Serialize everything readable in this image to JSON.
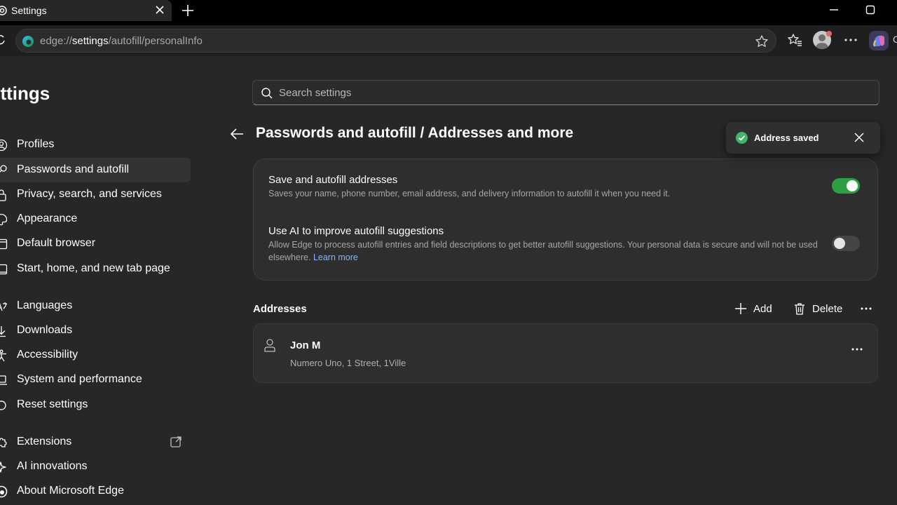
{
  "browser": {
    "tab_title": "Settings",
    "url_scheme": "edge://",
    "url_host": "settings",
    "url_path": "/autofill/personalInfo",
    "copilot_label": "C"
  },
  "sidebar": {
    "title": "ettings",
    "items": [
      {
        "label": "Profiles",
        "icon": "profile-icon"
      },
      {
        "label": "Passwords and autofill",
        "icon": "key-icon",
        "active": true
      },
      {
        "label": "Privacy, search, and services",
        "icon": "lock-icon"
      },
      {
        "label": "Appearance",
        "icon": "palette-icon"
      },
      {
        "label": "Default browser",
        "icon": "browser-icon"
      },
      {
        "label": "Start, home, and new tab page",
        "icon": "home-icon"
      },
      {
        "label": "Languages",
        "icon": "language-icon"
      },
      {
        "label": "Downloads",
        "icon": "download-icon"
      },
      {
        "label": "Accessibility",
        "icon": "accessibility-icon"
      },
      {
        "label": "System and performance",
        "icon": "laptop-icon"
      },
      {
        "label": "Reset settings",
        "icon": "reset-icon"
      },
      {
        "label": "Extensions",
        "icon": "puzzle-icon"
      },
      {
        "label": "AI innovations",
        "icon": "sparkle-icon"
      },
      {
        "label": "About Microsoft Edge",
        "icon": "edge-icon"
      }
    ]
  },
  "search": {
    "placeholder": "Search settings"
  },
  "main": {
    "heading": "Passwords and autofill / Addresses and more",
    "settings": [
      {
        "title": "Save and autofill addresses",
        "description": "Saves your name, phone number, email address, and delivery information to autofill it when you need it.",
        "enabled": true
      },
      {
        "title": "Use AI to improve autofill suggestions",
        "description": "Allow Edge to process autofill entries and field descriptions to get better autofill suggestions. Your personal data is secure and will not be used elsewhere.",
        "link": "Learn more",
        "enabled": false
      }
    ],
    "addresses": {
      "title": "Addresses",
      "add_label": "Add",
      "delete_label": "Delete",
      "entries": [
        {
          "name": "Jon M",
          "address": "Numero Uno, 1 Street, 1Ville"
        }
      ]
    }
  },
  "toast": {
    "message": "Address saved"
  },
  "colors": {
    "accent_green": "#2ea043",
    "link_blue": "#8ab4f8",
    "background": "#272727"
  }
}
